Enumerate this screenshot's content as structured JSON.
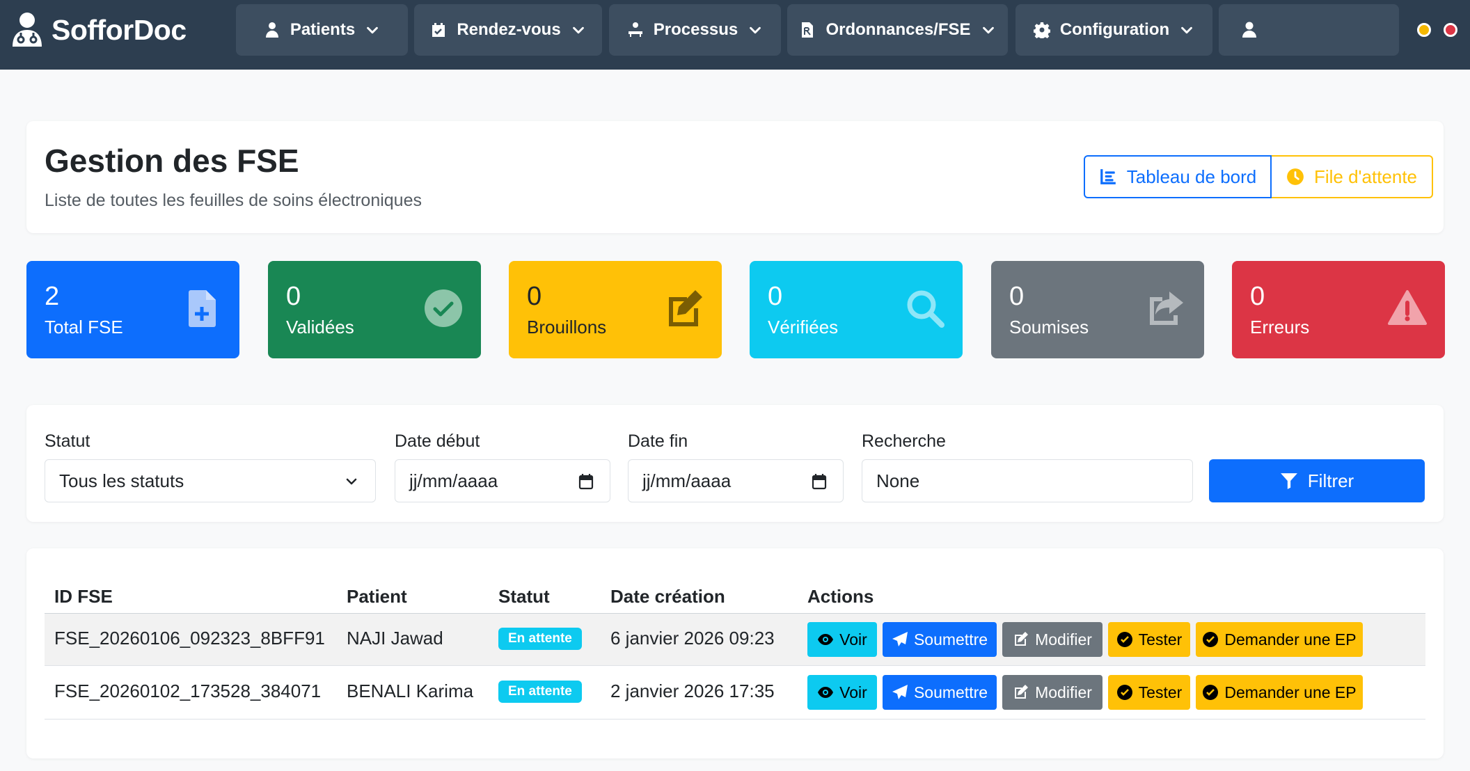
{
  "brand": {
    "name": "SofforDoc"
  },
  "nav": {
    "items": [
      {
        "label": "Patients",
        "icon": "user-doctor-icon"
      },
      {
        "label": "Rendez-vous",
        "icon": "calendar-check-icon"
      },
      {
        "label": "Processus",
        "icon": "procedures-icon"
      },
      {
        "label": "Ordonnances/FSE",
        "icon": "prescription-file-icon"
      },
      {
        "label": "Configuration",
        "icon": "gear-icon"
      }
    ],
    "user_icon": "user-icon",
    "status_dots": [
      "#f5b800",
      "#dc3545"
    ]
  },
  "header": {
    "title": "Gestion des FSE",
    "subtitle": "Liste de toutes les feuilles de soins électroniques",
    "dashboard_label": "Tableau de bord",
    "queue_label": "File d'attente"
  },
  "stats": [
    {
      "value": "2",
      "label": "Total FSE",
      "color": "#0d6efd",
      "icon": "file-plus-icon"
    },
    {
      "value": "0",
      "label": "Validées",
      "color": "#198754",
      "icon": "check-circle-icon"
    },
    {
      "value": "0",
      "label": "Brouillons",
      "color": "#ffc107",
      "icon": "edit-icon"
    },
    {
      "value": "0",
      "label": "Vérifiées",
      "color": "#0dcaf0",
      "icon": "search-icon"
    },
    {
      "value": "0",
      "label": "Soumises",
      "color": "#6c757d",
      "icon": "share-icon"
    },
    {
      "value": "0",
      "label": "Erreurs",
      "color": "#dc3545",
      "icon": "warning-icon"
    }
  ],
  "filters": {
    "status_label": "Statut",
    "status_value": "Tous les statuts",
    "start_label": "Date début",
    "start_placeholder": "jj/mm/aaaa",
    "end_label": "Date fin",
    "end_placeholder": "jj/mm/aaaa",
    "search_label": "Recherche",
    "search_value": "None",
    "filter_button": "Filtrer"
  },
  "table": {
    "headers": {
      "id": "ID FSE",
      "patient": "Patient",
      "status": "Statut",
      "date": "Date création",
      "actions": "Actions"
    },
    "action_labels": {
      "view": "Voir",
      "submit": "Soumettre",
      "edit": "Modifier",
      "test": "Tester",
      "ep": "Demander une EP"
    },
    "rows": [
      {
        "id": "FSE_20260106_092323_8BFF91",
        "patient": "NAJI Jawad",
        "status": "En attente",
        "date": "6 janvier 2026 09:23"
      },
      {
        "id": "FSE_20260102_173528_384071",
        "patient": "BENALI Karima",
        "status": "En attente",
        "date": "2 janvier 2026 17:35"
      }
    ]
  }
}
